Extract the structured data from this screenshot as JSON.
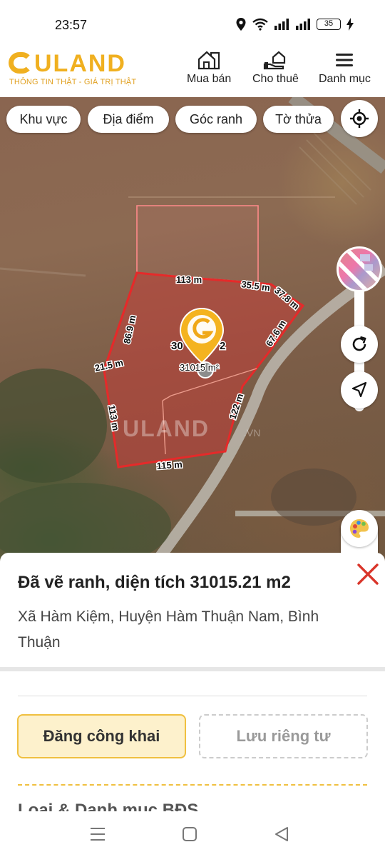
{
  "status": {
    "time": "23:57",
    "battery": "35"
  },
  "header": {
    "logo_text": "ULAND",
    "tagline": "THÔNG TIN THẬT - GIÁ TRỊ THẬT",
    "nav": [
      {
        "label": "Mua bán",
        "icon": "house-icon"
      },
      {
        "label": "Cho thuê",
        "icon": "hand-house-icon"
      },
      {
        "label": "Danh mục",
        "icon": "menu-icon"
      }
    ]
  },
  "map": {
    "filters": [
      "Khu vực",
      "Địa điểm",
      "Góc ranh",
      "Tờ thửa"
    ],
    "measurements": [
      "113 m",
      "35.5 m",
      "37.8 m",
      "86.9 m",
      "67.6 m",
      "21.5 m",
      "113 m",
      "122 m",
      "115 m"
    ],
    "marker_label": "30",
    "marker_label_tail": "2",
    "area_label": "31015 m²",
    "watermark": "ULAND",
    "watermark_suffix": ".VN"
  },
  "sheet": {
    "title": "Đã vẽ ranh, diện tích 31015.21 m2",
    "address": "Xã Hàm Kiệm, Huyện Hàm Thuận Nam, Bình Thuận",
    "btn_public": "Đăng công khai",
    "btn_private": "Lưu riêng tư",
    "next_section": "Loại & Danh mục BĐS"
  },
  "colors": {
    "brand": "#f0b020",
    "boundary": "#e52a2a",
    "close": "#d9352a"
  }
}
